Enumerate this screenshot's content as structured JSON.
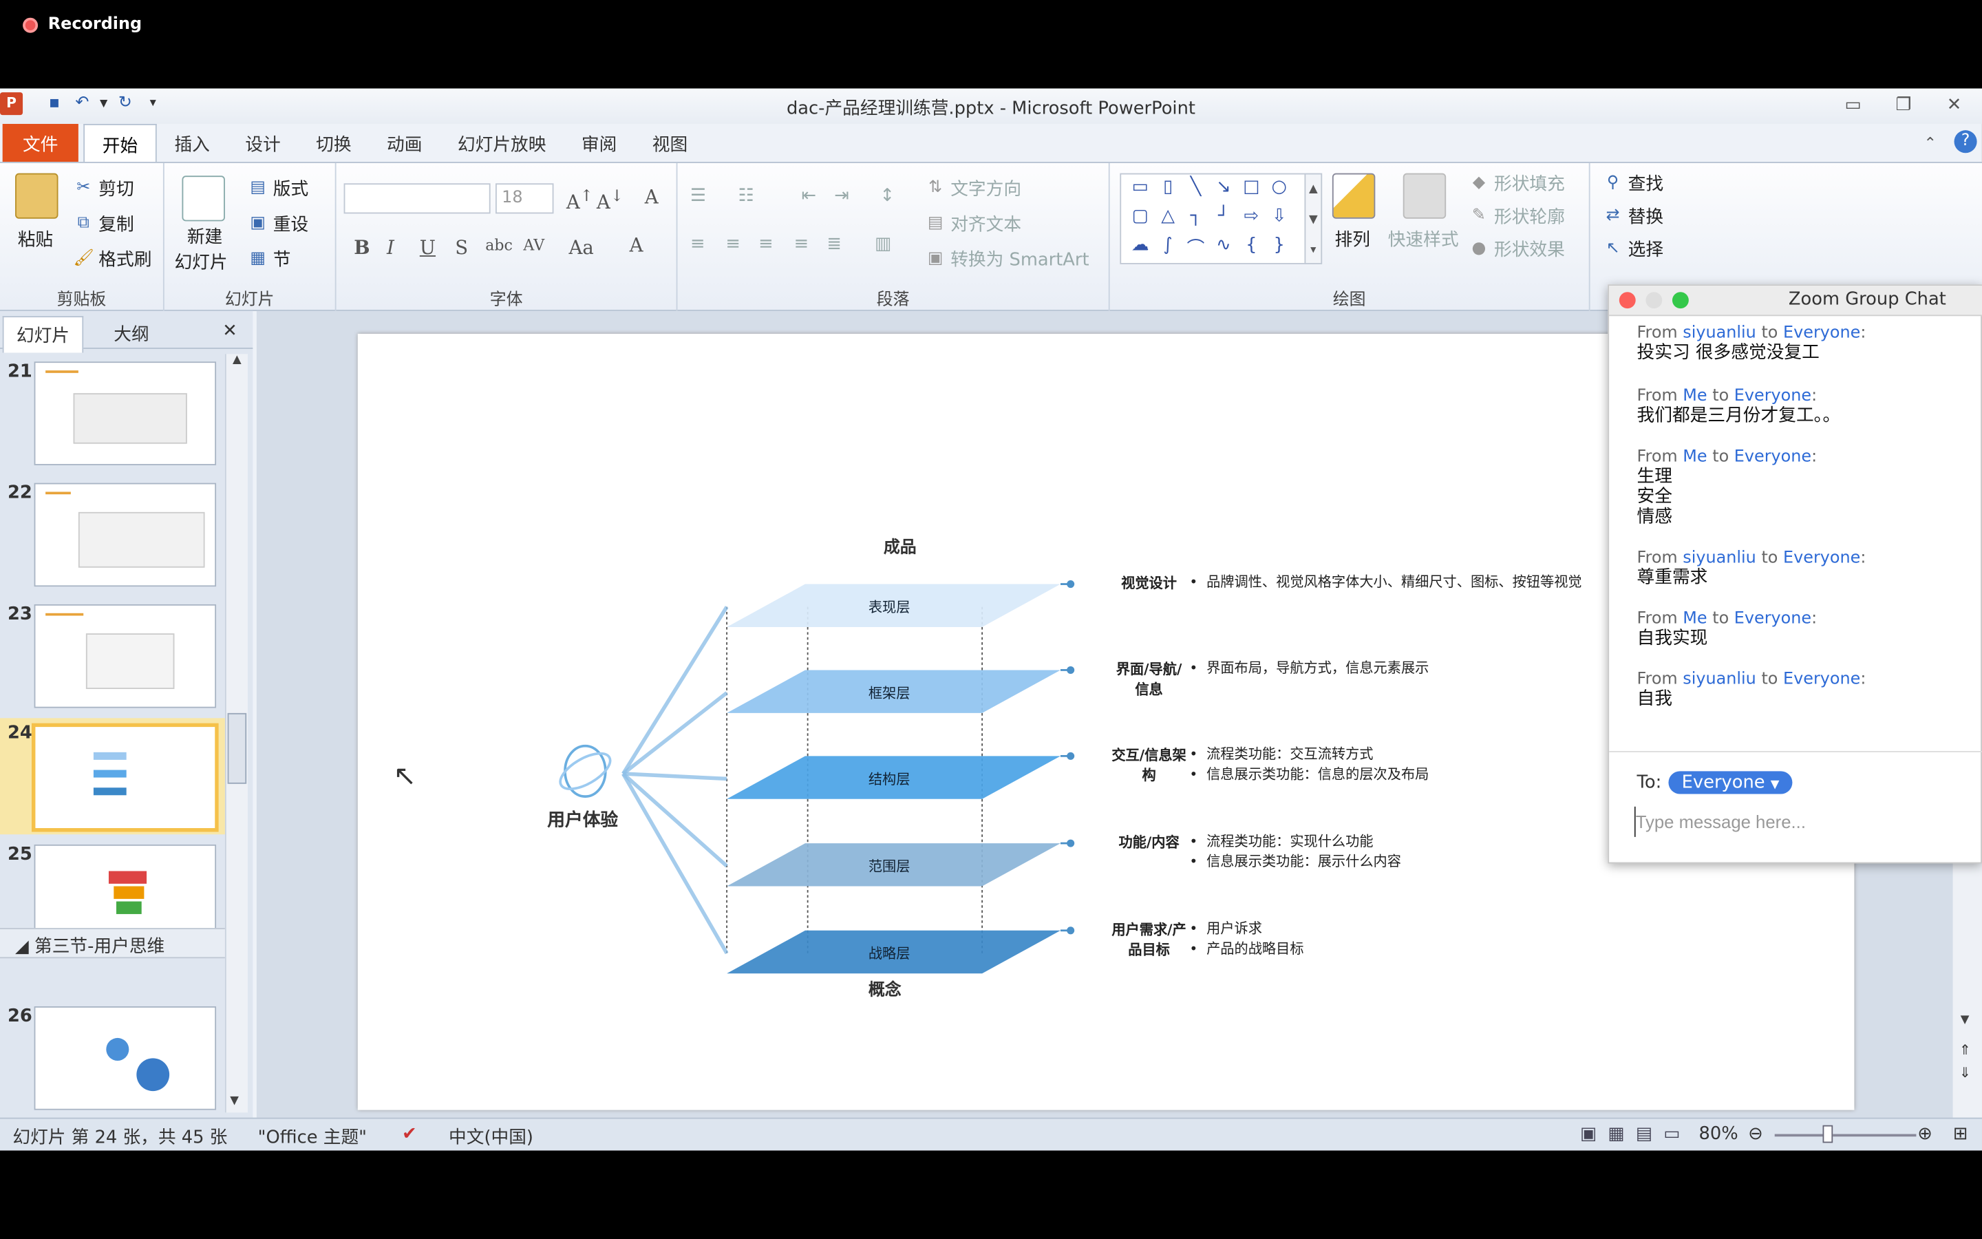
{
  "recording": {
    "label": "Recording"
  },
  "window": {
    "title": "dac-产品经理训练营.pptx - Microsoft PowerPoint"
  },
  "tabs": [
    "文件",
    "开始",
    "插入",
    "设计",
    "切换",
    "动画",
    "幻灯片放映",
    "审阅",
    "视图"
  ],
  "ribbon": {
    "clipboard": {
      "paste": "粘贴",
      "cut": "剪切",
      "copy": "复制",
      "format_painter": "格式刷",
      "label": "剪贴板"
    },
    "slides": {
      "new_slide_1": "新建",
      "new_slide_2": "幻灯片",
      "layout": "版式",
      "reset": "重设",
      "section": "节",
      "label": "幻灯片"
    },
    "font": {
      "size": "18",
      "label": "字体"
    },
    "paragraph": {
      "text_direction": "文字方向",
      "align_text": "对齐文本",
      "smartart": "转换为 SmartArt",
      "label": "段落"
    },
    "drawing": {
      "arrange": "排列",
      "quick_styles": "快速样式",
      "shape_fill": "形状填充",
      "shape_outline": "形状轮廓",
      "shape_effects": "形状效果",
      "label": "绘图"
    },
    "editing": {
      "find": "查找",
      "replace": "替换",
      "select": "选择"
    }
  },
  "left_pane": {
    "tab_slides": "幻灯片",
    "tab_outline": "大纲",
    "thumbs": [
      {
        "num": "21"
      },
      {
        "num": "22"
      },
      {
        "num": "23"
      },
      {
        "num": "24"
      },
      {
        "num": "25"
      },
      {
        "num": "26"
      }
    ],
    "section": "第三节-用户思维"
  },
  "diagram": {
    "top": "成品",
    "bottom": "概念",
    "center": "用户体验",
    "layers": [
      {
        "name": "表现层",
        "tag": "视觉设计",
        "points": [
          "品牌调性、视觉风格字体大小、精细尺寸、图标、按钮等视觉"
        ]
      },
      {
        "name": "框架层",
        "tag": "界面/导航/信息",
        "points": [
          "界面布局，导航方式，信息元素展示"
        ]
      },
      {
        "name": "结构层",
        "tag": "交互/信息架构",
        "points": [
          "流程类功能：交互流转方式",
          "信息展示类功能：信息的层次及布局"
        ]
      },
      {
        "name": "范围层",
        "tag": "功能/内容",
        "points": [
          "流程类功能：实现什么功能",
          "信息展示类功能：展示什么内容"
        ]
      },
      {
        "name": "战略层",
        "tag": "用户需求/产品目标",
        "points": [
          "用户诉求",
          "产品的战略目标"
        ]
      }
    ],
    "colors": [
      "#d8e9fa",
      "#8fc3f0",
      "#4aa3e6",
      "#8ab4d8",
      "#3b88c8"
    ]
  },
  "status": {
    "slide_info": "幻灯片 第 24 张，共 45 张",
    "theme": "\"Office 主题\"",
    "lang": "中文(中国)",
    "zoom": "80%"
  },
  "chat": {
    "title": "Zoom Group Chat",
    "messages": [
      {
        "from": "siyuanliu",
        "to": "Everyone",
        "body": "投实习 很多感觉没复工"
      },
      {
        "from": "Me",
        "to": "Everyone",
        "body": "我们都是三月份才复工。。"
      },
      {
        "from": "Me",
        "to": "Everyone",
        "body": "生理\n安全\n情感"
      },
      {
        "from": "siyuanliu",
        "to": "Everyone",
        "body": "尊重需求"
      },
      {
        "from": "Me",
        "to": "Everyone",
        "body": "自我实现"
      },
      {
        "from": "siyuanliu",
        "to": "Everyone",
        "body": "自我"
      }
    ],
    "to_label": "To:",
    "to_value": "Everyone",
    "placeholder": "Type message here...",
    "from_word": "From",
    "to_word": "to"
  }
}
